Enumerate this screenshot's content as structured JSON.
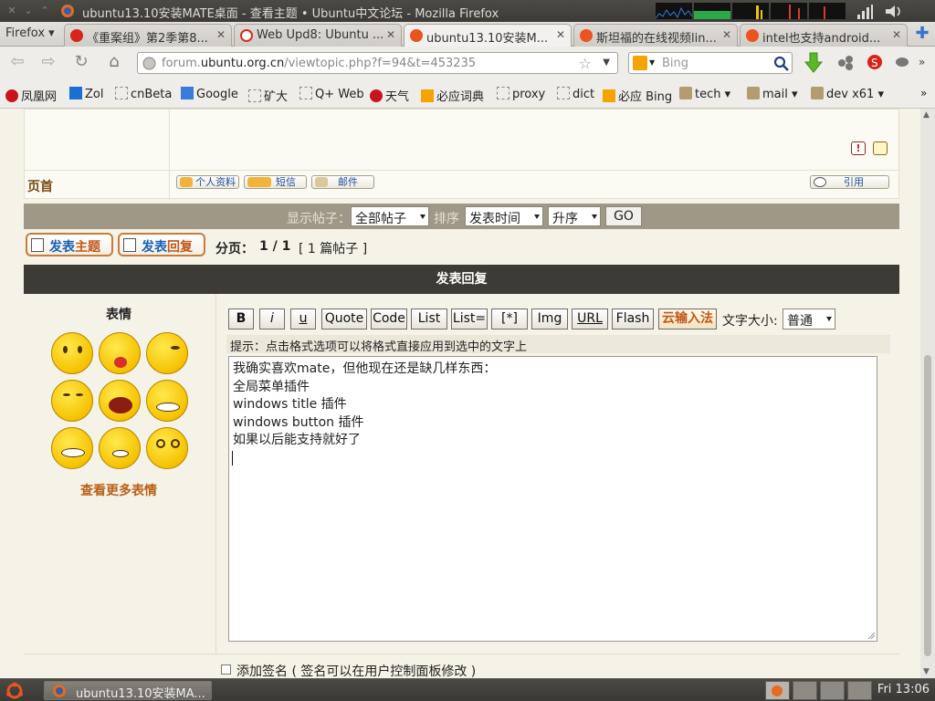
{
  "window": {
    "title": "ubuntu13.10安装MATE桌面 - 查看主题 • Ubuntu中文论坛 - Mozilla Firefox"
  },
  "tabs": {
    "menu_label": "Firefox",
    "items": [
      {
        "label": "《重案组》第2季第8...",
        "icon_color": "#d6261b"
      },
      {
        "label": "Web Upd8: Ubuntu ...",
        "icon_color": "#f2f2f2"
      },
      {
        "label": "ubuntu13.10安装M...",
        "icon_color": "#e95420",
        "active": true
      },
      {
        "label": "斯坦福的在线视频lin...",
        "icon_color": "#e95420"
      },
      {
        "label": "intel也支持android...",
        "icon_color": "#e95420"
      }
    ]
  },
  "nav": {
    "url_host": "forum.",
    "url_domain": "ubuntu.org.cn",
    "url_path": "/viewtopic.php?f=94&t=453235",
    "search_placeholder": "Bing"
  },
  "bookmarks": [
    {
      "label": "凤凰网",
      "icon_color": "#c8141e"
    },
    {
      "label": "Zol",
      "icon_color": "#1b6fcf"
    },
    {
      "label": "cnBeta",
      "icon_color": "#ffffff"
    },
    {
      "label": "Google",
      "icon_color": "#3b7bd8"
    },
    {
      "label": "矿大",
      "icon_color": "#ffffff"
    },
    {
      "label": "Q+ Web",
      "icon_color": "#ffffff"
    },
    {
      "label": "天气",
      "icon_color": "#c8141e"
    },
    {
      "label": "必应词典",
      "icon_color": "#f4a300"
    },
    {
      "label": "proxy",
      "icon_color": "#ffffff"
    },
    {
      "label": "dict",
      "icon_color": "#ffffff"
    },
    {
      "label": "必应 Bing",
      "icon_color": "#f4a300"
    },
    {
      "label": "tech ▾",
      "icon_color": "#b39b72"
    },
    {
      "label": "mail ▾",
      "icon_color": "#b39b72"
    },
    {
      "label": "dev x61 ▾",
      "icon_color": "#b39b72"
    }
  ],
  "post": {
    "page_top_label": "页首",
    "profile_btn": "个人资料",
    "pm_btn": "短信",
    "email_btn": "邮件",
    "quote_btn": "引用"
  },
  "filter": {
    "label_show": "显示帖子：",
    "show_value": "全部帖子",
    "label_sort": "排序",
    "sort_value": "发表时间",
    "order_value": "升序",
    "go": "GO"
  },
  "actions": {
    "new_topic_prefix": "发表",
    "new_topic_suffix": "主题",
    "reply_prefix": "发表",
    "reply_suffix": "回复",
    "pagination_label": "分页：",
    "pagination_value": "1 / 1",
    "post_count": "[ 1 篇帖子 ]"
  },
  "reply": {
    "header": "发表回复",
    "emoticons_title": "表情",
    "more_emoticons": "查看更多表情",
    "format_buttons": [
      "B",
      "i",
      "u",
      "Quote",
      "Code",
      "List",
      "List=",
      "[*]",
      "Img",
      "URL",
      "Flash"
    ],
    "cloud_input": "云输入法",
    "font_size_label": "文字大小:",
    "font_size_value": "普通",
    "hint": "提示：点击格式选项可以将格式直接应用到选中的文字上",
    "lines": [
      "我确实喜欢mate，但他现在还是缺几样东西：",
      "全局菜单插件",
      "windows title 插件",
      "windows button 插件",
      "如果以后能支持就好了"
    ],
    "signature_label": "添加签名 ( 签名可以在用户控制面板修改 )"
  },
  "taskbar": {
    "task_label": "ubuntu13.10安装MA...",
    "clock": "Fri 13:06"
  }
}
